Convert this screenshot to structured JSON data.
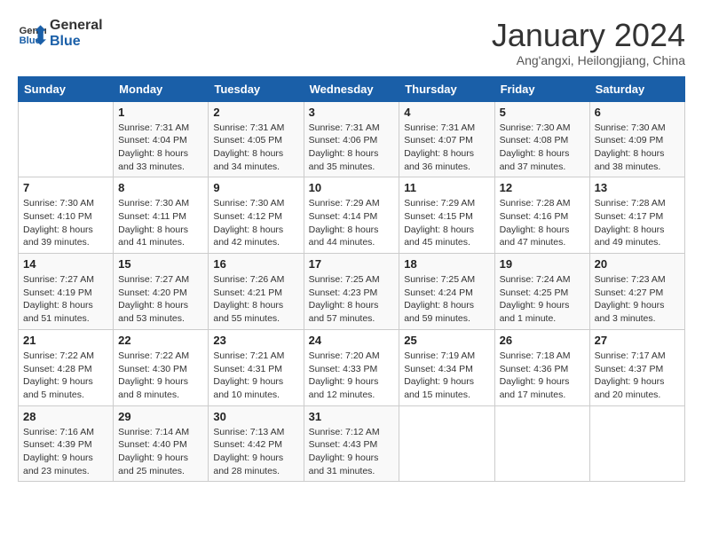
{
  "header": {
    "logo_line1": "General",
    "logo_line2": "Blue",
    "month_title": "January 2024",
    "subtitle": "Ang'angxi, Heilongjiang, China"
  },
  "weekdays": [
    "Sunday",
    "Monday",
    "Tuesday",
    "Wednesday",
    "Thursday",
    "Friday",
    "Saturday"
  ],
  "weeks": [
    [
      {
        "day": "",
        "sunrise": "",
        "sunset": "",
        "daylight": ""
      },
      {
        "day": "1",
        "sunrise": "Sunrise: 7:31 AM",
        "sunset": "Sunset: 4:04 PM",
        "daylight": "Daylight: 8 hours and 33 minutes."
      },
      {
        "day": "2",
        "sunrise": "Sunrise: 7:31 AM",
        "sunset": "Sunset: 4:05 PM",
        "daylight": "Daylight: 8 hours and 34 minutes."
      },
      {
        "day": "3",
        "sunrise": "Sunrise: 7:31 AM",
        "sunset": "Sunset: 4:06 PM",
        "daylight": "Daylight: 8 hours and 35 minutes."
      },
      {
        "day": "4",
        "sunrise": "Sunrise: 7:31 AM",
        "sunset": "Sunset: 4:07 PM",
        "daylight": "Daylight: 8 hours and 36 minutes."
      },
      {
        "day": "5",
        "sunrise": "Sunrise: 7:30 AM",
        "sunset": "Sunset: 4:08 PM",
        "daylight": "Daylight: 8 hours and 37 minutes."
      },
      {
        "day": "6",
        "sunrise": "Sunrise: 7:30 AM",
        "sunset": "Sunset: 4:09 PM",
        "daylight": "Daylight: 8 hours and 38 minutes."
      }
    ],
    [
      {
        "day": "7",
        "sunrise": "Sunrise: 7:30 AM",
        "sunset": "Sunset: 4:10 PM",
        "daylight": "Daylight: 8 hours and 39 minutes."
      },
      {
        "day": "8",
        "sunrise": "Sunrise: 7:30 AM",
        "sunset": "Sunset: 4:11 PM",
        "daylight": "Daylight: 8 hours and 41 minutes."
      },
      {
        "day": "9",
        "sunrise": "Sunrise: 7:30 AM",
        "sunset": "Sunset: 4:12 PM",
        "daylight": "Daylight: 8 hours and 42 minutes."
      },
      {
        "day": "10",
        "sunrise": "Sunrise: 7:29 AM",
        "sunset": "Sunset: 4:14 PM",
        "daylight": "Daylight: 8 hours and 44 minutes."
      },
      {
        "day": "11",
        "sunrise": "Sunrise: 7:29 AM",
        "sunset": "Sunset: 4:15 PM",
        "daylight": "Daylight: 8 hours and 45 minutes."
      },
      {
        "day": "12",
        "sunrise": "Sunrise: 7:28 AM",
        "sunset": "Sunset: 4:16 PM",
        "daylight": "Daylight: 8 hours and 47 minutes."
      },
      {
        "day": "13",
        "sunrise": "Sunrise: 7:28 AM",
        "sunset": "Sunset: 4:17 PM",
        "daylight": "Daylight: 8 hours and 49 minutes."
      }
    ],
    [
      {
        "day": "14",
        "sunrise": "Sunrise: 7:27 AM",
        "sunset": "Sunset: 4:19 PM",
        "daylight": "Daylight: 8 hours and 51 minutes."
      },
      {
        "day": "15",
        "sunrise": "Sunrise: 7:27 AM",
        "sunset": "Sunset: 4:20 PM",
        "daylight": "Daylight: 8 hours and 53 minutes."
      },
      {
        "day": "16",
        "sunrise": "Sunrise: 7:26 AM",
        "sunset": "Sunset: 4:21 PM",
        "daylight": "Daylight: 8 hours and 55 minutes."
      },
      {
        "day": "17",
        "sunrise": "Sunrise: 7:25 AM",
        "sunset": "Sunset: 4:23 PM",
        "daylight": "Daylight: 8 hours and 57 minutes."
      },
      {
        "day": "18",
        "sunrise": "Sunrise: 7:25 AM",
        "sunset": "Sunset: 4:24 PM",
        "daylight": "Daylight: 8 hours and 59 minutes."
      },
      {
        "day": "19",
        "sunrise": "Sunrise: 7:24 AM",
        "sunset": "Sunset: 4:25 PM",
        "daylight": "Daylight: 9 hours and 1 minute."
      },
      {
        "day": "20",
        "sunrise": "Sunrise: 7:23 AM",
        "sunset": "Sunset: 4:27 PM",
        "daylight": "Daylight: 9 hours and 3 minutes."
      }
    ],
    [
      {
        "day": "21",
        "sunrise": "Sunrise: 7:22 AM",
        "sunset": "Sunset: 4:28 PM",
        "daylight": "Daylight: 9 hours and 5 minutes."
      },
      {
        "day": "22",
        "sunrise": "Sunrise: 7:22 AM",
        "sunset": "Sunset: 4:30 PM",
        "daylight": "Daylight: 9 hours and 8 minutes."
      },
      {
        "day": "23",
        "sunrise": "Sunrise: 7:21 AM",
        "sunset": "Sunset: 4:31 PM",
        "daylight": "Daylight: 9 hours and 10 minutes."
      },
      {
        "day": "24",
        "sunrise": "Sunrise: 7:20 AM",
        "sunset": "Sunset: 4:33 PM",
        "daylight": "Daylight: 9 hours and 12 minutes."
      },
      {
        "day": "25",
        "sunrise": "Sunrise: 7:19 AM",
        "sunset": "Sunset: 4:34 PM",
        "daylight": "Daylight: 9 hours and 15 minutes."
      },
      {
        "day": "26",
        "sunrise": "Sunrise: 7:18 AM",
        "sunset": "Sunset: 4:36 PM",
        "daylight": "Daylight: 9 hours and 17 minutes."
      },
      {
        "day": "27",
        "sunrise": "Sunrise: 7:17 AM",
        "sunset": "Sunset: 4:37 PM",
        "daylight": "Daylight: 9 hours and 20 minutes."
      }
    ],
    [
      {
        "day": "28",
        "sunrise": "Sunrise: 7:16 AM",
        "sunset": "Sunset: 4:39 PM",
        "daylight": "Daylight: 9 hours and 23 minutes."
      },
      {
        "day": "29",
        "sunrise": "Sunrise: 7:14 AM",
        "sunset": "Sunset: 4:40 PM",
        "daylight": "Daylight: 9 hours and 25 minutes."
      },
      {
        "day": "30",
        "sunrise": "Sunrise: 7:13 AM",
        "sunset": "Sunset: 4:42 PM",
        "daylight": "Daylight: 9 hours and 28 minutes."
      },
      {
        "day": "31",
        "sunrise": "Sunrise: 7:12 AM",
        "sunset": "Sunset: 4:43 PM",
        "daylight": "Daylight: 9 hours and 31 minutes."
      },
      {
        "day": "",
        "sunrise": "",
        "sunset": "",
        "daylight": ""
      },
      {
        "day": "",
        "sunrise": "",
        "sunset": "",
        "daylight": ""
      },
      {
        "day": "",
        "sunrise": "",
        "sunset": "",
        "daylight": ""
      }
    ]
  ]
}
